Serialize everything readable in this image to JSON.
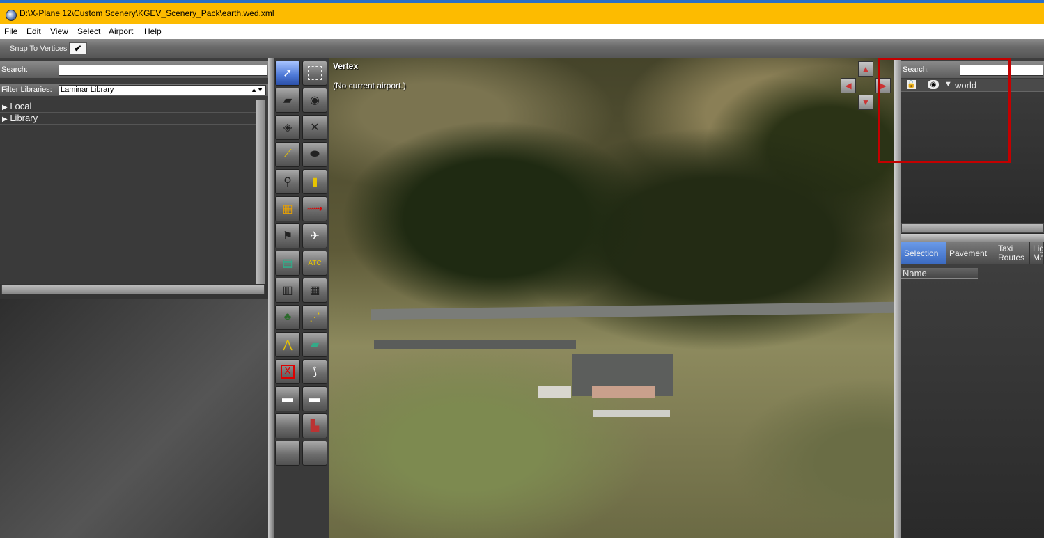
{
  "window": {
    "title": "D:\\X-Plane 12\\Custom Scenery\\KGEV_Scenery_Pack\\earth.wed.xml"
  },
  "menu": [
    "File",
    "Edit",
    "View",
    "Select",
    "Airport",
    "Help"
  ],
  "toolbar": {
    "snap_label": "Snap To Vertices",
    "snap_checked": "✔"
  },
  "library_panel": {
    "search_label": "Search:",
    "search_value": "",
    "filter_label": "Filter Libraries:",
    "filter_value": "Laminar Library",
    "items": [
      "Local",
      "Library"
    ]
  },
  "map": {
    "tool_name": "Vertex",
    "airport_status": "(No current airport.)"
  },
  "hierarchy_panel": {
    "search_label": "Search:",
    "search_value": "",
    "root_item": "world"
  },
  "property_tabs": {
    "tabs": [
      {
        "label": "Selection"
      },
      {
        "label": "Pavement"
      },
      {
        "label": "Taxi Routes"
      },
      {
        "label": "Lig Ma"
      }
    ],
    "column_header": "Name"
  },
  "colors": {
    "title_bar": "#fdbb00",
    "highlight_box": "#c40000",
    "active_tab": "#4a7ad0"
  }
}
